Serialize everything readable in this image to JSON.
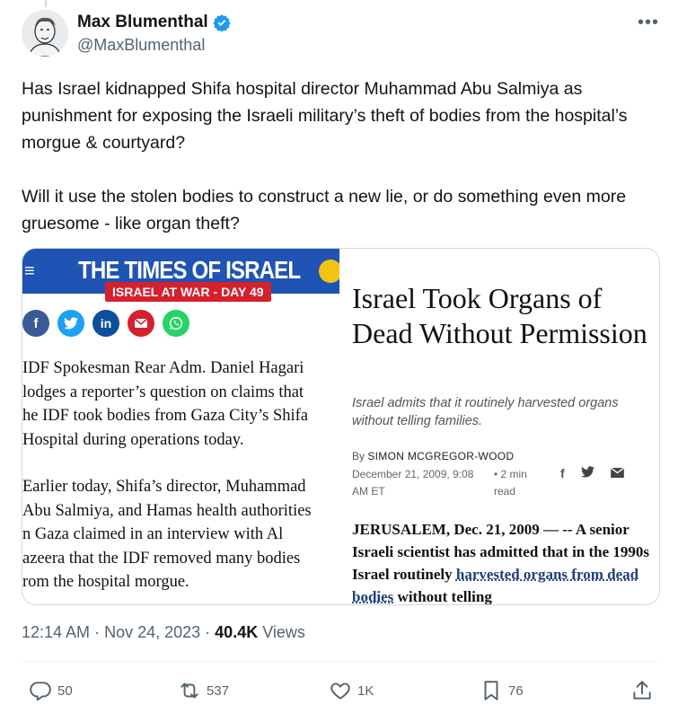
{
  "author": {
    "name": "Max Blumenthal",
    "handle": "@MaxBlumenthal",
    "verified": true,
    "avatar_icon": "portrait-sketch"
  },
  "more_label": "•••",
  "tweet_text": [
    "Has Israel kidnapped Shifa hospital director Muhammad Abu Salmiya as punishment for exposing the Israeli military’s theft of bodies from the hospital’s morgue & courtyard?",
    "Will it use the stolen bodies to construct a new lie, or do something even more gruesome - like organ theft?"
  ],
  "image_left": {
    "masthead": "THE TIMES OF ISRAEL",
    "menu_icon": "≡",
    "badge": "ISRAEL AT WAR - DAY 49",
    "share_icons": [
      "facebook-icon",
      "twitter-icon",
      "linkedin-icon",
      "email-icon",
      "whatsapp-icon"
    ],
    "colors": {
      "banner": "#1f53b4",
      "badge": "#d5202e"
    },
    "paragraphs": [
      [
        "IDF Spokesman Rear Adm. Daniel Hagari",
        "lodges a reporter’s question on claims that",
        "he IDF took bodies from Gaza City’s Shifa",
        "Hospital during operations today."
      ],
      [
        "Earlier today, Shifa’s director, Muhammad",
        "Abu Salmiya, and Hamas health authorities",
        "n Gaza claimed in an interview with Al",
        "azeera that the IDF removed many bodies",
        "rom the hospital morgue."
      ]
    ]
  },
  "image_right": {
    "headline": "Israel Took Organs of Dead Without Permission",
    "subhead": "Israel admits that it routinely harvested organs without telling families.",
    "by_label": "By",
    "author": "SIMON MCGREGOR-WOOD",
    "date": "December 21, 2009, 9:08 AM ET",
    "read_time": "• 2 min read",
    "body_lead": "JERUSALEM, Dec. 21, 2009 — -- A senior Israeli scientist has admitted that in the 1990s Israel routinely ",
    "body_link": "harvested organs from dead bodies",
    "body_tail": " without telling"
  },
  "meta": {
    "time": "12:14 AM",
    "date": "Nov 24, 2023",
    "views_count": "40.4K",
    "views_label": "Views"
  },
  "actions": {
    "replies": "50",
    "reposts": "537",
    "likes": "1K",
    "bookmarks": "76"
  }
}
